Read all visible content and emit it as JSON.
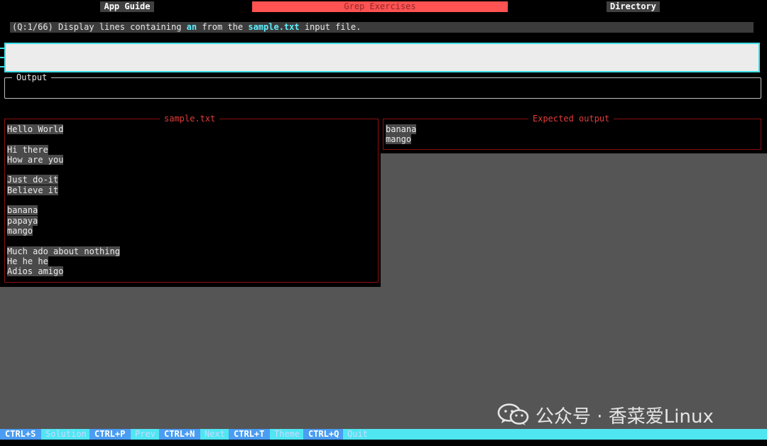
{
  "header": {
    "tabs": [
      {
        "label": "App Guide"
      },
      {
        "label": "Grep Exercises"
      },
      {
        "label": "Directory"
      }
    ]
  },
  "question": {
    "prefix": "(Q:1/66) Display lines containing ",
    "pattern": "an",
    "middle": " from the ",
    "filename": "sample.txt",
    "suffix": " input file."
  },
  "command_input": {
    "value": "",
    "placeholder": ""
  },
  "output": {
    "label": "Output",
    "content": ""
  },
  "sample_file": {
    "title": "sample.txt",
    "lines": [
      "Hello World",
      "",
      "Hi there",
      "How are you",
      "",
      "Just do-it",
      "Believe it",
      "",
      "banana",
      "papaya",
      "mango",
      "",
      "Much ado about nothing",
      "He he he",
      "Adios amigo"
    ]
  },
  "expected_output": {
    "title": "Expected output",
    "lines": [
      "banana",
      "mango"
    ]
  },
  "footer": {
    "shortcuts": [
      {
        "key": "CTRL+S",
        "action": "Solution"
      },
      {
        "key": "CTRL+P",
        "action": "Prev"
      },
      {
        "key": "CTRL+N",
        "action": "Next"
      },
      {
        "key": "CTRL+T",
        "action": "Theme"
      },
      {
        "key": "CTRL+Q",
        "action": "Quit"
      }
    ]
  },
  "watermark": {
    "text": "公众号 · 香菜爱Linux",
    "icon": "wechat-icon"
  },
  "colors": {
    "active_tab": "#ff5252",
    "accent_cyan": "#3fdde6",
    "panel_border": "#8b0f0f",
    "panel_title": "#e23b3b",
    "footer_bg": "#4fe6f2",
    "footer_key": "#4a9df2"
  }
}
